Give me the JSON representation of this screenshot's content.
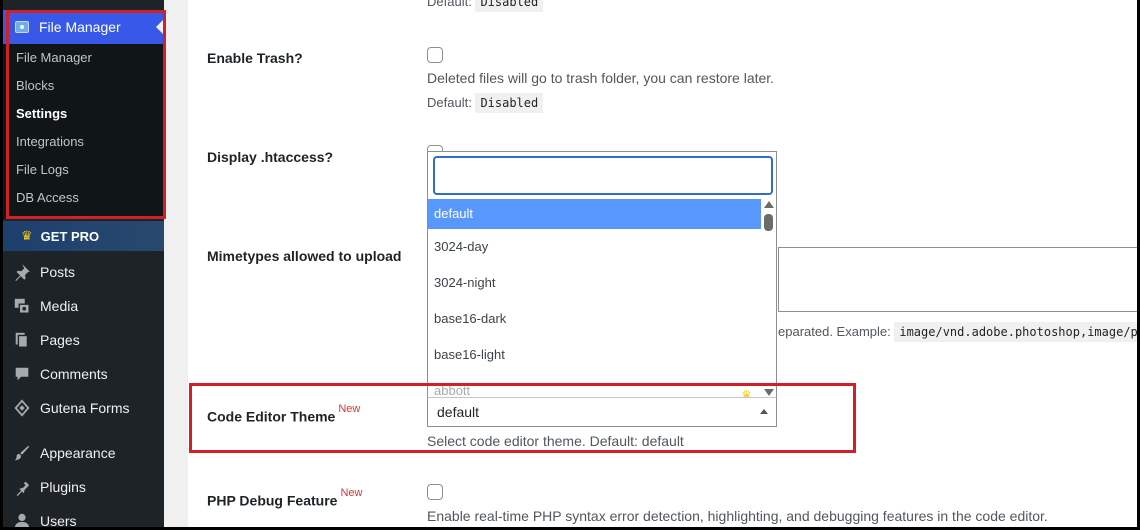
{
  "sidebar": {
    "header_label": "File Manager",
    "submenu": [
      {
        "label": "File Manager",
        "active": false
      },
      {
        "label": "Blocks",
        "active": false
      },
      {
        "label": "Settings",
        "active": true
      },
      {
        "label": "Integrations",
        "active": false
      },
      {
        "label": "File Logs",
        "active": false
      },
      {
        "label": "DB Access",
        "active": false
      }
    ],
    "getpro_label": "GET PRO",
    "menu": [
      {
        "label": "Posts",
        "icon": "pin-icon"
      },
      {
        "label": "Media",
        "icon": "media-icon"
      },
      {
        "label": "Pages",
        "icon": "pages-icon"
      },
      {
        "label": "Comments",
        "icon": "comment-icon"
      },
      {
        "label": "Gutena Forms",
        "icon": "forms-icon"
      },
      {
        "label": "Appearance",
        "icon": "brush-icon"
      },
      {
        "label": "Plugins",
        "icon": "plugin-icon"
      },
      {
        "label": "Users",
        "icon": "users-icon"
      }
    ],
    "colors": {
      "bg": "#1d2327",
      "header": "#3858e9",
      "highlight": "#d12027"
    }
  },
  "content": {
    "top_default_label": "Default:",
    "top_default_value": "Disabled",
    "trash": {
      "label": "Enable Trash?",
      "description": "Deleted files will go to trash folder, you can restore later.",
      "default_label": "Default:",
      "default_value": "Disabled"
    },
    "htaccess": {
      "label": "Display .htaccess?"
    },
    "mimetypes": {
      "label": "Mimetypes allowed to upload",
      "desc_fragment": "eparated. Example:",
      "example": "image/vnd.adobe.photoshop,image/p"
    },
    "code_theme": {
      "label": "Code Editor Theme",
      "badge": "New",
      "selected": "default",
      "description": "Select code editor theme. Default: default",
      "search_placeholder": "",
      "options": [
        "default",
        "3024-day",
        "3024-night",
        "base16-dark",
        "base16-light",
        "abbott"
      ]
    },
    "php_debug": {
      "label": "PHP Debug Feature",
      "badge": "New",
      "description": "Enable real-time PHP syntax error detection, highlighting, and debugging features in the code editor."
    }
  }
}
